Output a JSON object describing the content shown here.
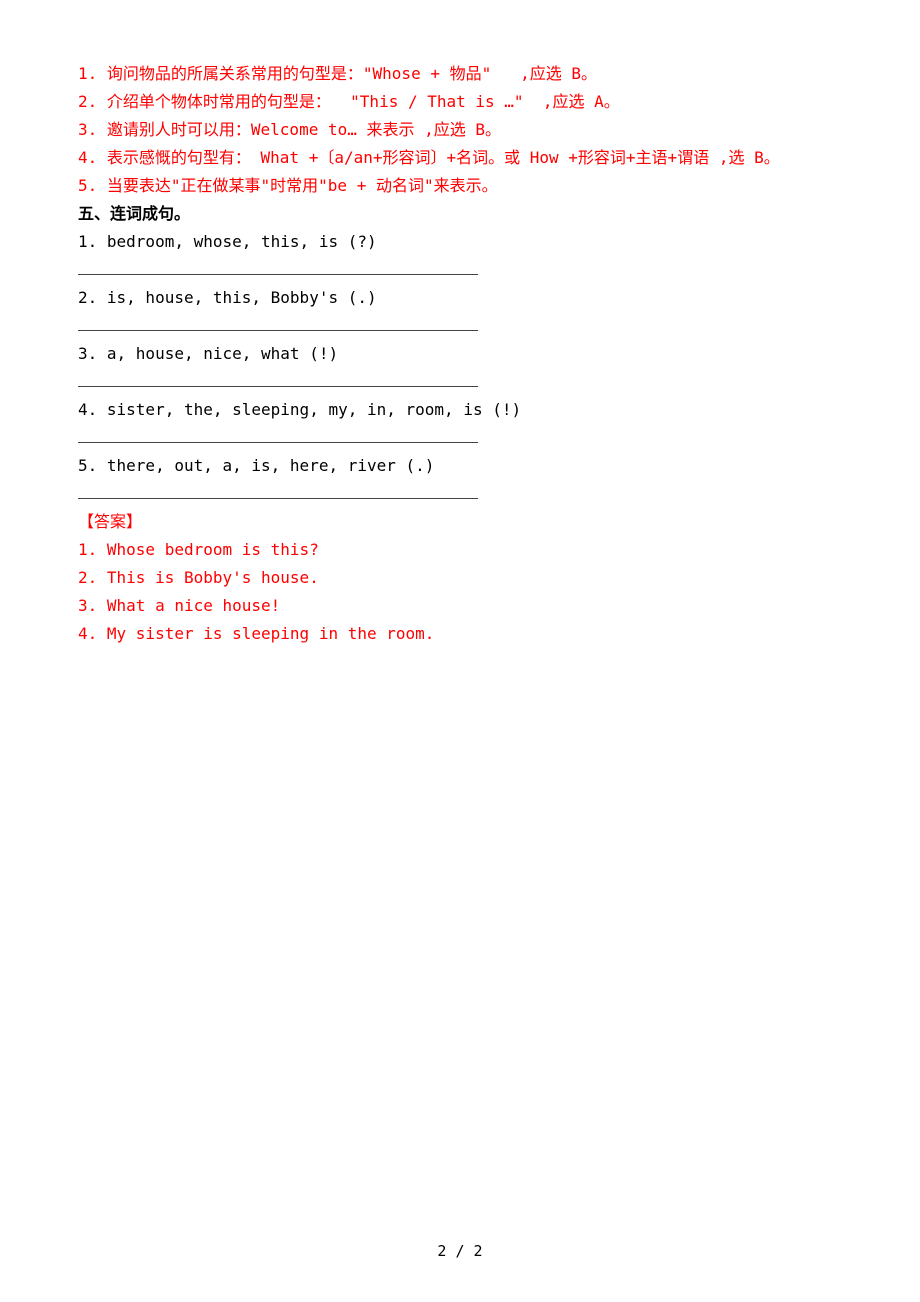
{
  "intro": {
    "i1": "1. 询问物品的所属关系常用的句型是：\"Whose + 物品\"   ,应选 B。",
    "i2": "2. 介绍单个物体时常用的句型是：  \"This / That is …\"  ,应选 A。",
    "i3": "3. 邀请别人时可以用：Welcome to… 来表示 ,应选 B。",
    "i4": "4. 表示感慨的句型有： What +〔a/an+形容词〕+名词。或 How +形容词+主语+谓语 ,选 B。",
    "i5": "5. 当要表达\"正在做某事\"时常用\"be + 动名词\"来表示。"
  },
  "section_title": "五、连词成句。",
  "questions": {
    "q1": "1. bedroom, whose, this, is (?)",
    "q2": "2. is, house, this, Bobby's (.)",
    "q3": "3. a, house, nice, what (!)",
    "q4": "4. sister, the, sleeping, my, in, room, is (!)",
    "q5": "5. there, out, a, is, here, river (.)"
  },
  "answers_label": "【答案】",
  "answers": {
    "a1": "1. Whose bedroom is this?",
    "a2": "2. This is Bobby's house.",
    "a3": "3. What a nice house!",
    "a4": "4. My sister is sleeping in the room."
  },
  "footer": "2 / 2"
}
